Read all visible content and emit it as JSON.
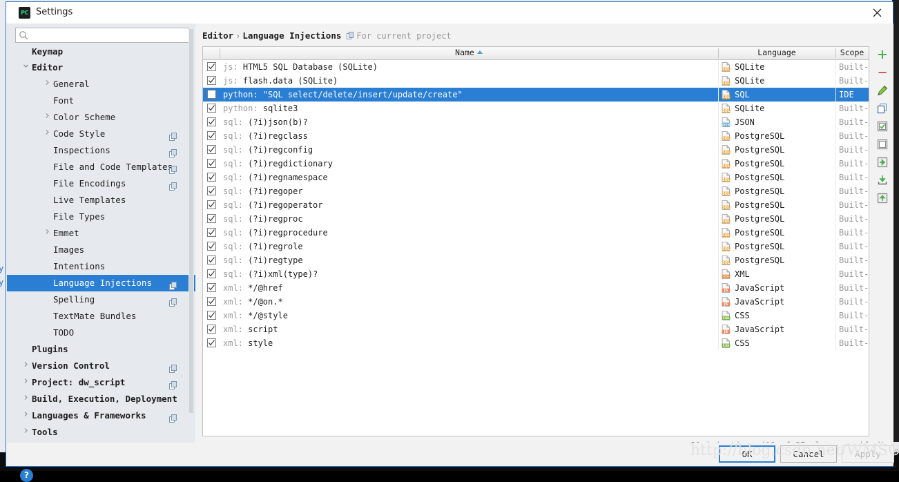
{
  "window": {
    "title": "Settings",
    "app_icon_text": "PC",
    "close_icon": "close-icon"
  },
  "search": {
    "value": "",
    "placeholder": "",
    "icon": "search-icon"
  },
  "sidebar": {
    "items": [
      {
        "label": "Keymap",
        "indent": 0,
        "arrow": "",
        "bold": true,
        "clipped": true,
        "copy": false,
        "selected": false
      },
      {
        "label": "Editor",
        "indent": 0,
        "arrow": "v",
        "bold": true,
        "clipped": false,
        "copy": false,
        "selected": false
      },
      {
        "label": "General",
        "indent": 1,
        "arrow": ">",
        "bold": false,
        "clipped": false,
        "copy": false,
        "selected": false
      },
      {
        "label": "Font",
        "indent": 1,
        "arrow": "",
        "bold": false,
        "clipped": false,
        "copy": false,
        "selected": false
      },
      {
        "label": "Color Scheme",
        "indent": 1,
        "arrow": ">",
        "bold": false,
        "clipped": false,
        "copy": false,
        "selected": false
      },
      {
        "label": "Code Style",
        "indent": 1,
        "arrow": ">",
        "bold": false,
        "clipped": false,
        "copy": true,
        "selected": false
      },
      {
        "label": "Inspections",
        "indent": 1,
        "arrow": "",
        "bold": false,
        "clipped": false,
        "copy": true,
        "selected": false
      },
      {
        "label": "File and Code Templates",
        "indent": 1,
        "arrow": "",
        "bold": false,
        "clipped": false,
        "copy": true,
        "selected": false
      },
      {
        "label": "File Encodings",
        "indent": 1,
        "arrow": "",
        "bold": false,
        "clipped": false,
        "copy": true,
        "selected": false
      },
      {
        "label": "Live Templates",
        "indent": 1,
        "arrow": "",
        "bold": false,
        "clipped": false,
        "copy": false,
        "selected": false
      },
      {
        "label": "File Types",
        "indent": 1,
        "arrow": "",
        "bold": false,
        "clipped": false,
        "copy": false,
        "selected": false
      },
      {
        "label": "Emmet",
        "indent": 1,
        "arrow": ">",
        "bold": false,
        "clipped": false,
        "copy": false,
        "selected": false
      },
      {
        "label": "Images",
        "indent": 1,
        "arrow": "",
        "bold": false,
        "clipped": false,
        "copy": false,
        "selected": false
      },
      {
        "label": "Intentions",
        "indent": 1,
        "arrow": "",
        "bold": false,
        "clipped": false,
        "copy": false,
        "selected": false
      },
      {
        "label": "Language Injections",
        "indent": 1,
        "arrow": "",
        "bold": false,
        "clipped": false,
        "copy": true,
        "selected": true
      },
      {
        "label": "Spelling",
        "indent": 1,
        "arrow": "",
        "bold": false,
        "clipped": false,
        "copy": true,
        "selected": false
      },
      {
        "label": "TextMate Bundles",
        "indent": 1,
        "arrow": "",
        "bold": false,
        "clipped": false,
        "copy": false,
        "selected": false
      },
      {
        "label": "TODO",
        "indent": 1,
        "arrow": "",
        "bold": false,
        "clipped": false,
        "copy": false,
        "selected": false
      },
      {
        "label": "Plugins",
        "indent": 0,
        "arrow": "",
        "bold": true,
        "clipped": false,
        "copy": false,
        "selected": false
      },
      {
        "label": "Version Control",
        "indent": 0,
        "arrow": ">",
        "bold": true,
        "clipped": false,
        "copy": true,
        "selected": false
      },
      {
        "label": "Project: dw_script",
        "indent": 0,
        "arrow": ">",
        "bold": true,
        "clipped": false,
        "copy": true,
        "selected": false
      },
      {
        "label": "Build, Execution, Deployment",
        "indent": 0,
        "arrow": ">",
        "bold": true,
        "clipped": false,
        "copy": false,
        "selected": false
      },
      {
        "label": "Languages & Frameworks",
        "indent": 0,
        "arrow": ">",
        "bold": true,
        "clipped": false,
        "copy": true,
        "selected": false
      },
      {
        "label": "Tools",
        "indent": 0,
        "arrow": ">",
        "bold": true,
        "clipped": false,
        "copy": false,
        "selected": false
      }
    ],
    "help_label": "?"
  },
  "breadcrumb": {
    "root": "Editor",
    "separator": "›",
    "leaf": "Language Injections",
    "scope_note": "For current project"
  },
  "table": {
    "headers": {
      "name": "Name",
      "language": "Language",
      "scope": "Scope"
    },
    "sort_column": "Name",
    "sort_dir": "asc",
    "rows": [
      {
        "checked": true,
        "prefix": "js: ",
        "name": "HTML5 SQL Database (SQLite)",
        "language": "SQLite",
        "lang_icon": "sql",
        "scope": "Built-in",
        "selected": false
      },
      {
        "checked": true,
        "prefix": "js: ",
        "name": "flash.data (SQLite)",
        "language": "SQLite",
        "lang_icon": "sql",
        "scope": "Built-in",
        "selected": false
      },
      {
        "checked": false,
        "prefix": "python: ",
        "name": "\"SQL select/delete/insert/update/create\"",
        "language": "SQL",
        "lang_icon": "sql",
        "scope": "IDE",
        "selected": true
      },
      {
        "checked": true,
        "prefix": "python: ",
        "name": "sqlite3",
        "language": "SQLite",
        "lang_icon": "sql",
        "scope": "Built-in",
        "selected": false
      },
      {
        "checked": true,
        "prefix": "sql: ",
        "name": "(?i)json(b)?",
        "language": "JSON",
        "lang_icon": "json",
        "scope": "Built-in",
        "selected": false
      },
      {
        "checked": true,
        "prefix": "sql: ",
        "name": "(?i)regclass",
        "language": "PostgreSQL",
        "lang_icon": "sql",
        "scope": "Built-in",
        "selected": false
      },
      {
        "checked": true,
        "prefix": "sql: ",
        "name": "(?i)regconfig",
        "language": "PostgreSQL",
        "lang_icon": "sql",
        "scope": "Built-in",
        "selected": false
      },
      {
        "checked": true,
        "prefix": "sql: ",
        "name": "(?i)regdictionary",
        "language": "PostgreSQL",
        "lang_icon": "sql",
        "scope": "Built-in",
        "selected": false
      },
      {
        "checked": true,
        "prefix": "sql: ",
        "name": "(?i)regnamespace",
        "language": "PostgreSQL",
        "lang_icon": "sql",
        "scope": "Built-in",
        "selected": false
      },
      {
        "checked": true,
        "prefix": "sql: ",
        "name": "(?i)regoper",
        "language": "PostgreSQL",
        "lang_icon": "sql",
        "scope": "Built-in",
        "selected": false
      },
      {
        "checked": true,
        "prefix": "sql: ",
        "name": "(?i)regoperator",
        "language": "PostgreSQL",
        "lang_icon": "sql",
        "scope": "Built-in",
        "selected": false
      },
      {
        "checked": true,
        "prefix": "sql: ",
        "name": "(?i)regproc",
        "language": "PostgreSQL",
        "lang_icon": "sql",
        "scope": "Built-in",
        "selected": false
      },
      {
        "checked": true,
        "prefix": "sql: ",
        "name": "(?i)regprocedure",
        "language": "PostgreSQL",
        "lang_icon": "sql",
        "scope": "Built-in",
        "selected": false
      },
      {
        "checked": true,
        "prefix": "sql: ",
        "name": "(?i)regrole",
        "language": "PostgreSQL",
        "lang_icon": "sql",
        "scope": "Built-in",
        "selected": false
      },
      {
        "checked": true,
        "prefix": "sql: ",
        "name": "(?i)regtype",
        "language": "PostgreSQL",
        "lang_icon": "sql",
        "scope": "Built-in",
        "selected": false
      },
      {
        "checked": true,
        "prefix": "sql: ",
        "name": "(?i)xml(type)?",
        "language": "XML",
        "lang_icon": "xml",
        "scope": "Built-in",
        "selected": false
      },
      {
        "checked": true,
        "prefix": "xml: ",
        "name": "*/@href",
        "language": "JavaScript",
        "lang_icon": "js",
        "scope": "Built-in",
        "selected": false
      },
      {
        "checked": true,
        "prefix": "xml: ",
        "name": "*/@on.*",
        "language": "JavaScript",
        "lang_icon": "js",
        "scope": "Built-in",
        "selected": false
      },
      {
        "checked": true,
        "prefix": "xml: ",
        "name": "*/@style",
        "language": "CSS",
        "lang_icon": "css",
        "scope": "Built-in",
        "selected": false
      },
      {
        "checked": true,
        "prefix": "xml: ",
        "name": "script",
        "language": "JavaScript",
        "lang_icon": "js",
        "scope": "Built-in",
        "selected": false
      },
      {
        "checked": true,
        "prefix": "xml: ",
        "name": "style",
        "language": "CSS",
        "lang_icon": "css",
        "scope": "Built-in",
        "selected": false
      }
    ],
    "status": "21 injections (13 of 37 places enabled)"
  },
  "toolbar": {
    "buttons": [
      {
        "name": "add-injection-button",
        "icon": "plus-icon"
      },
      {
        "name": "remove-injection-button",
        "icon": "minus-icon"
      },
      {
        "name": "edit-injection-button",
        "icon": "pencil-icon"
      },
      {
        "name": "duplicate-injection-button",
        "icon": "copy-icon"
      },
      {
        "name": "enable-all-button",
        "icon": "checked-box-icon"
      },
      {
        "name": "disable-all-button",
        "icon": "empty-box-icon"
      },
      {
        "name": "move-to-ide-button",
        "icon": "import-arrow-icon"
      },
      {
        "name": "import-button",
        "icon": "download-icon"
      },
      {
        "name": "export-button",
        "icon": "export-icon"
      }
    ]
  },
  "footer": {
    "ok": "OK",
    "cancel": "Cancel",
    "apply": "Apply",
    "apply_enabled": false
  },
  "watermark": {
    "text": "http://blog.csdn.net/WMSOK"
  },
  "colors": {
    "selection": "#2a7fd4",
    "sidebar_bg": "#e6eaee",
    "dialog_bg": "#f2f2f2",
    "accent_border": "#2a6fc4"
  }
}
